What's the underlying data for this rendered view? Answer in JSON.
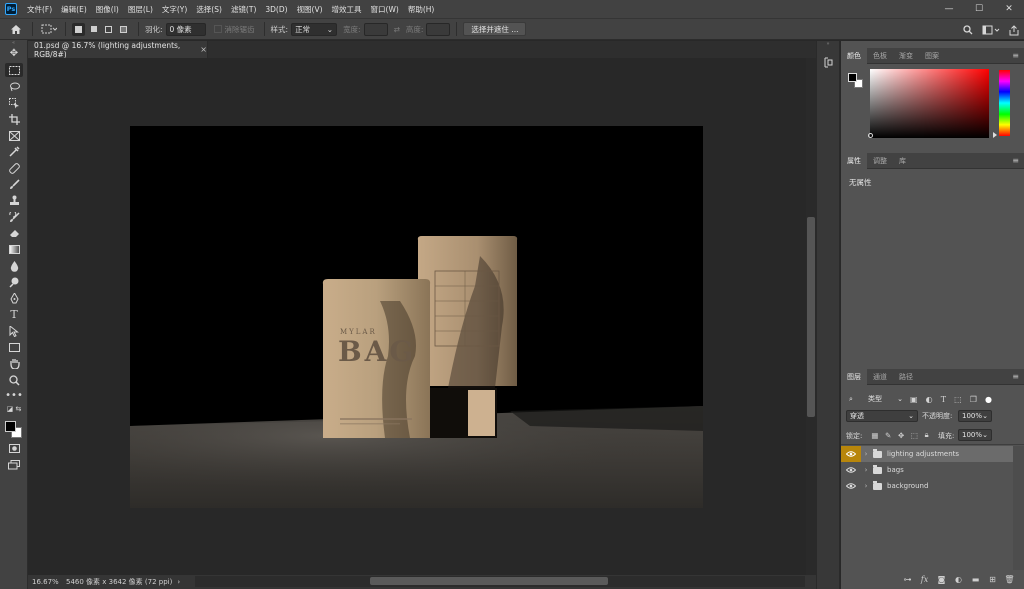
{
  "app": {
    "logo": "Ps"
  },
  "menu": [
    "文件(F)",
    "编辑(E)",
    "图像(I)",
    "图层(L)",
    "文字(Y)",
    "选择(S)",
    "滤镜(T)",
    "3D(D)",
    "视图(V)",
    "增效工具",
    "窗口(W)",
    "帮助(H)"
  ],
  "window_controls": {
    "minimize": "—",
    "maximize": "☐",
    "close": "✕"
  },
  "options": {
    "feather_label": "羽化:",
    "feather_value": "0 像素",
    "antialias_label": "消除锯齿",
    "style_label": "样式:",
    "style_value": "正常",
    "width_label": "宽度:",
    "height_label": "高度:",
    "select_mask_button": "选择并遮住 ..."
  },
  "document": {
    "tab_title": "01.psd @ 16.7% (lighting adjustments, RGB/8#)",
    "close": "×",
    "zoom": "16.67%",
    "doc_info": "5460 像素 x 3642 像素 (72 ppi)",
    "arrow": "›"
  },
  "image_content": {
    "pouch_brand": "MYLAR",
    "pouch_title": "BAG"
  },
  "color_panel": {
    "tabs": [
      "颜色",
      "色板",
      "渐变",
      "图案"
    ],
    "active_tab": 0
  },
  "properties_panel": {
    "tabs": [
      "属性",
      "调整",
      "库"
    ],
    "active_tab": 0,
    "empty_text": "无属性"
  },
  "layers_panel": {
    "tabs": [
      "图层",
      "通道",
      "路径"
    ],
    "active_tab": 0,
    "filter_label": "类型",
    "blend_mode": "穿透",
    "opacity_label": "不透明度:",
    "opacity_value": "100%",
    "lock_label": "锁定:",
    "fill_label": "填充:",
    "fill_value": "100%",
    "layers": [
      {
        "name": "lighting adjustments",
        "selected": true
      },
      {
        "name": "bags",
        "selected": false
      },
      {
        "name": "background",
        "selected": false
      }
    ]
  },
  "colors": {
    "foreground": "#000000",
    "background": "#ffffff",
    "eye_selected": "#b8860b"
  }
}
